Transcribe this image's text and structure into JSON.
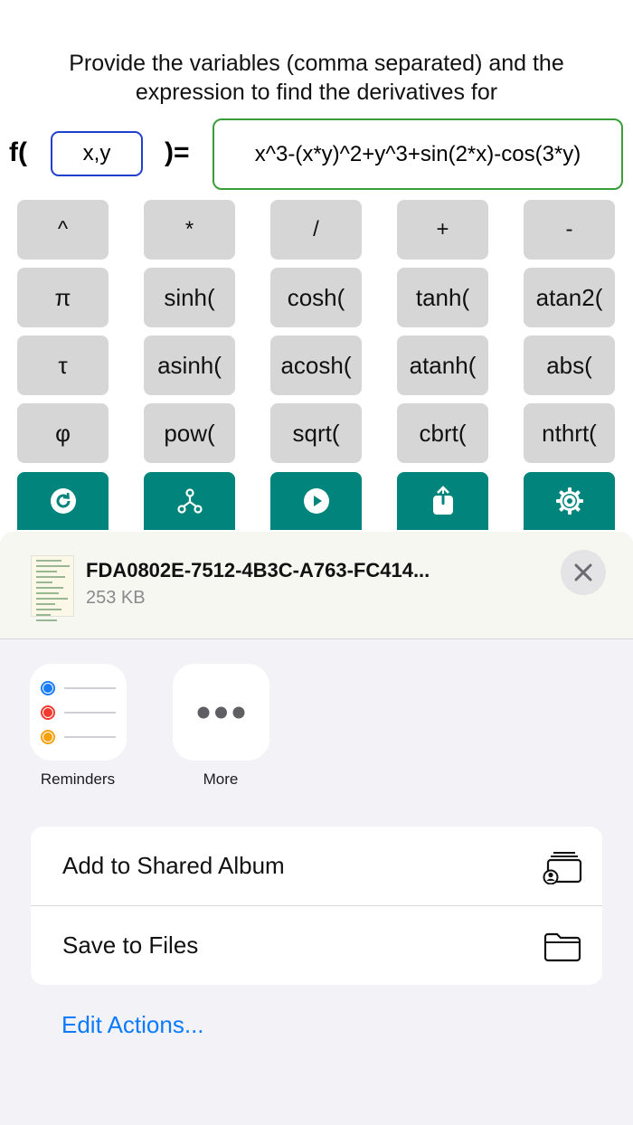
{
  "app": {
    "prompt_line1": "Provide the variables (comma separated) and the",
    "prompt_line2": "expression to find the derivatives for",
    "f_label": "f(",
    "eq_label": ")=",
    "variables_value": "x,y",
    "expression_value": "x^3-(x*y)^2+y^3+sin(2*x)-cos(3*y)",
    "keypad": [
      [
        "^",
        "*",
        "/",
        "+",
        "-"
      ],
      [
        "π",
        "sinh(",
        "cosh(",
        "tanh(",
        "atan2("
      ],
      [
        "τ",
        "asinh(",
        "acosh(",
        "atanh(",
        "abs("
      ],
      [
        "φ",
        "pow(",
        "sqrt(",
        "cbrt(",
        "nthrt("
      ]
    ],
    "action_icons": [
      "refresh-icon",
      "tree-icon",
      "play-icon",
      "share-icon",
      "settings-icon"
    ],
    "accent_color": "#00847b"
  },
  "share_sheet": {
    "file_name": "FDA0802E-7512-4B3C-A763-FC414...",
    "file_size": "253 KB",
    "apps": [
      {
        "label": "Reminders",
        "icon": "reminders-icon"
      },
      {
        "label": "More",
        "icon": "more-icon"
      }
    ],
    "actions": [
      {
        "label": "Add to Shared Album",
        "icon": "shared-album-icon"
      },
      {
        "label": "Save to Files",
        "icon": "folder-icon"
      }
    ],
    "edit_actions_label": "Edit Actions...",
    "link_color": "#0a7aff"
  }
}
